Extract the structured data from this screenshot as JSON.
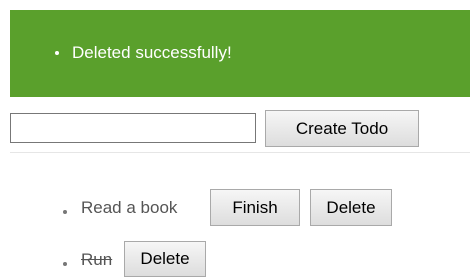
{
  "flash": {
    "message": "Deleted successfully!"
  },
  "form": {
    "input_value": "",
    "input_placeholder": "",
    "create_label": "Create Todo"
  },
  "todos": [
    {
      "text": "Read a book",
      "completed": false,
      "finish_label": "Finish",
      "delete_label": "Delete"
    },
    {
      "text": "Run",
      "completed": true,
      "delete_label": "Delete"
    }
  ],
  "colors": {
    "flash_background": "#5aa02c",
    "flash_text": "#ffffff",
    "body_text": "#555555"
  }
}
